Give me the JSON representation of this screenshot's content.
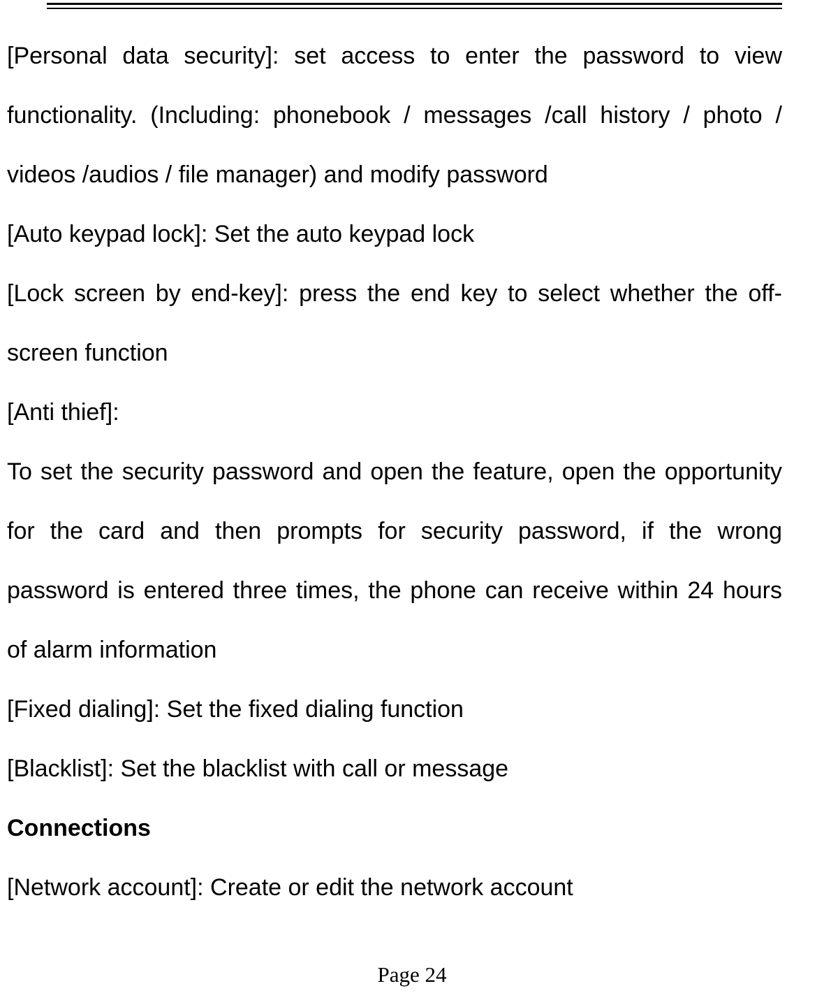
{
  "paragraphs": {
    "p1": "[Personal data security]: set access to enter the password to view functionality. (Including: phonebook / messages /call history / photo / videos /audios / file manager) and modify password",
    "p2": "[Auto keypad lock]: Set the auto keypad lock",
    "p3": "[Lock screen by end-key]: press the end key to select whether the off-screen function",
    "p4": "[Anti thief]:",
    "p5": "To set the security password and open the feature, open the opportunity for the card and then prompts for security password, if the wrong password is entered three times, the phone can receive within 24 hours of alarm information",
    "p6": "[Fixed dialing]: Set the fixed dialing function",
    "p7": "[Blacklist]: Set the blacklist with call or message",
    "heading": "Connections",
    "p8": "[Network account]: Create or edit the network account"
  },
  "footer": {
    "page_label": "Page 24"
  }
}
